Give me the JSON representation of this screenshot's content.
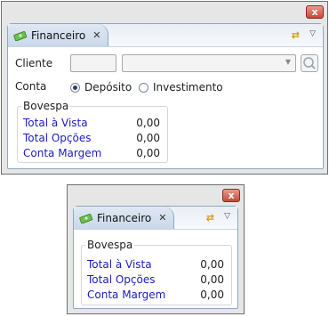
{
  "window1": {
    "close_label": "x",
    "tab_title": "Financeiro",
    "tab_close": "✕",
    "link_icon": "⇄",
    "menu_icon": "▽",
    "cliente_label": "Cliente",
    "cliente_code_value": "",
    "cliente_name_value": "",
    "combo_arrow": "▼",
    "conta_label": "Conta",
    "radio_deposito": "Depósito",
    "radio_investimento": "Investimento",
    "selected_conta": "Depósito",
    "group_title": "Bovespa",
    "rows": [
      {
        "label": "Total à Vista",
        "value": "0,00"
      },
      {
        "label": "Total Opções",
        "value": "0,00"
      },
      {
        "label": "Conta Margem",
        "value": "0,00"
      }
    ]
  },
  "window2": {
    "close_label": "x",
    "tab_title": "Financeiro",
    "tab_close": "✕",
    "link_icon": "⇄",
    "menu_icon": "▽",
    "group_title": "Bovespa",
    "rows": [
      {
        "label": "Total à Vista",
        "value": "0,00"
      },
      {
        "label": "Total Opções",
        "value": "0,00"
      },
      {
        "label": "Conta Margem",
        "value": "0,00"
      }
    ]
  },
  "colors": {
    "accent_link": "#1b1bc2",
    "close_red": "#c34a35",
    "tab_blue": "#c9d8ea"
  }
}
